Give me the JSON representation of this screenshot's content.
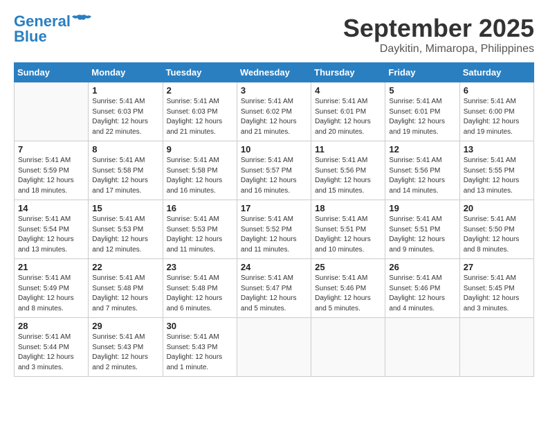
{
  "header": {
    "logo_line1": "General",
    "logo_line2": "Blue",
    "month_title": "September 2025",
    "subtitle": "Daykitin, Mimaropa, Philippines"
  },
  "weekdays": [
    "Sunday",
    "Monday",
    "Tuesday",
    "Wednesday",
    "Thursday",
    "Friday",
    "Saturday"
  ],
  "weeks": [
    [
      {
        "num": "",
        "info": ""
      },
      {
        "num": "1",
        "info": "Sunrise: 5:41 AM\nSunset: 6:03 PM\nDaylight: 12 hours\nand 22 minutes."
      },
      {
        "num": "2",
        "info": "Sunrise: 5:41 AM\nSunset: 6:03 PM\nDaylight: 12 hours\nand 21 minutes."
      },
      {
        "num": "3",
        "info": "Sunrise: 5:41 AM\nSunset: 6:02 PM\nDaylight: 12 hours\nand 21 minutes."
      },
      {
        "num": "4",
        "info": "Sunrise: 5:41 AM\nSunset: 6:01 PM\nDaylight: 12 hours\nand 20 minutes."
      },
      {
        "num": "5",
        "info": "Sunrise: 5:41 AM\nSunset: 6:01 PM\nDaylight: 12 hours\nand 19 minutes."
      },
      {
        "num": "6",
        "info": "Sunrise: 5:41 AM\nSunset: 6:00 PM\nDaylight: 12 hours\nand 19 minutes."
      }
    ],
    [
      {
        "num": "7",
        "info": "Sunrise: 5:41 AM\nSunset: 5:59 PM\nDaylight: 12 hours\nand 18 minutes."
      },
      {
        "num": "8",
        "info": "Sunrise: 5:41 AM\nSunset: 5:58 PM\nDaylight: 12 hours\nand 17 minutes."
      },
      {
        "num": "9",
        "info": "Sunrise: 5:41 AM\nSunset: 5:58 PM\nDaylight: 12 hours\nand 16 minutes."
      },
      {
        "num": "10",
        "info": "Sunrise: 5:41 AM\nSunset: 5:57 PM\nDaylight: 12 hours\nand 16 minutes."
      },
      {
        "num": "11",
        "info": "Sunrise: 5:41 AM\nSunset: 5:56 PM\nDaylight: 12 hours\nand 15 minutes."
      },
      {
        "num": "12",
        "info": "Sunrise: 5:41 AM\nSunset: 5:56 PM\nDaylight: 12 hours\nand 14 minutes."
      },
      {
        "num": "13",
        "info": "Sunrise: 5:41 AM\nSunset: 5:55 PM\nDaylight: 12 hours\nand 13 minutes."
      }
    ],
    [
      {
        "num": "14",
        "info": "Sunrise: 5:41 AM\nSunset: 5:54 PM\nDaylight: 12 hours\nand 13 minutes."
      },
      {
        "num": "15",
        "info": "Sunrise: 5:41 AM\nSunset: 5:53 PM\nDaylight: 12 hours\nand 12 minutes."
      },
      {
        "num": "16",
        "info": "Sunrise: 5:41 AM\nSunset: 5:53 PM\nDaylight: 12 hours\nand 11 minutes."
      },
      {
        "num": "17",
        "info": "Sunrise: 5:41 AM\nSunset: 5:52 PM\nDaylight: 12 hours\nand 11 minutes."
      },
      {
        "num": "18",
        "info": "Sunrise: 5:41 AM\nSunset: 5:51 PM\nDaylight: 12 hours\nand 10 minutes."
      },
      {
        "num": "19",
        "info": "Sunrise: 5:41 AM\nSunset: 5:51 PM\nDaylight: 12 hours\nand 9 minutes."
      },
      {
        "num": "20",
        "info": "Sunrise: 5:41 AM\nSunset: 5:50 PM\nDaylight: 12 hours\nand 8 minutes."
      }
    ],
    [
      {
        "num": "21",
        "info": "Sunrise: 5:41 AM\nSunset: 5:49 PM\nDaylight: 12 hours\nand 8 minutes."
      },
      {
        "num": "22",
        "info": "Sunrise: 5:41 AM\nSunset: 5:48 PM\nDaylight: 12 hours\nand 7 minutes."
      },
      {
        "num": "23",
        "info": "Sunrise: 5:41 AM\nSunset: 5:48 PM\nDaylight: 12 hours\nand 6 minutes."
      },
      {
        "num": "24",
        "info": "Sunrise: 5:41 AM\nSunset: 5:47 PM\nDaylight: 12 hours\nand 5 minutes."
      },
      {
        "num": "25",
        "info": "Sunrise: 5:41 AM\nSunset: 5:46 PM\nDaylight: 12 hours\nand 5 minutes."
      },
      {
        "num": "26",
        "info": "Sunrise: 5:41 AM\nSunset: 5:46 PM\nDaylight: 12 hours\nand 4 minutes."
      },
      {
        "num": "27",
        "info": "Sunrise: 5:41 AM\nSunset: 5:45 PM\nDaylight: 12 hours\nand 3 minutes."
      }
    ],
    [
      {
        "num": "28",
        "info": "Sunrise: 5:41 AM\nSunset: 5:44 PM\nDaylight: 12 hours\nand 3 minutes."
      },
      {
        "num": "29",
        "info": "Sunrise: 5:41 AM\nSunset: 5:43 PM\nDaylight: 12 hours\nand 2 minutes."
      },
      {
        "num": "30",
        "info": "Sunrise: 5:41 AM\nSunset: 5:43 PM\nDaylight: 12 hours\nand 1 minute."
      },
      {
        "num": "",
        "info": ""
      },
      {
        "num": "",
        "info": ""
      },
      {
        "num": "",
        "info": ""
      },
      {
        "num": "",
        "info": ""
      }
    ]
  ]
}
